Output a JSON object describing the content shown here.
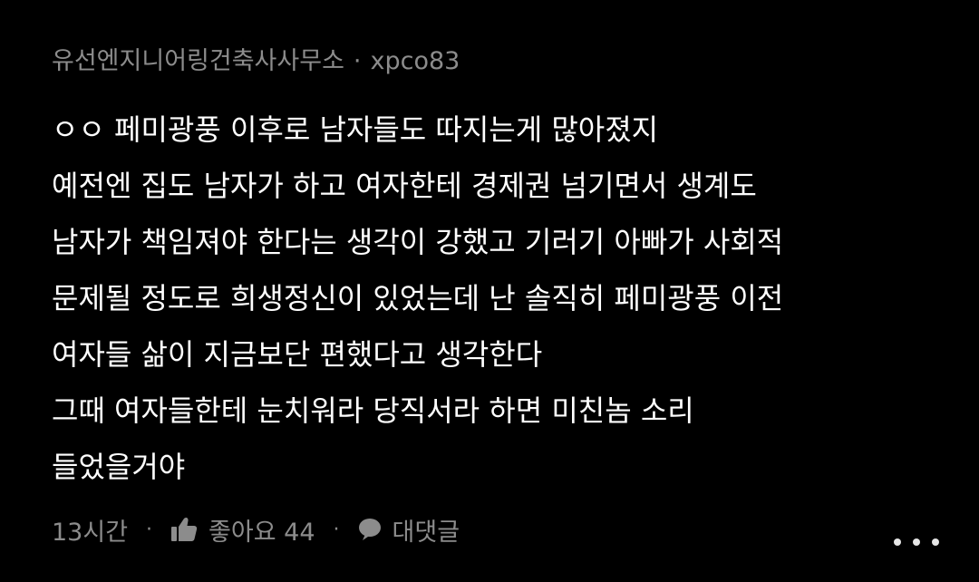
{
  "comment": {
    "author": "유선엔지니어링건축사사무소",
    "separator": "·",
    "username": "xpco83",
    "lines": [
      "ㅇㅇ 페미광풍 이후로 남자들도 따지는게 많아졌지",
      "예전엔 집도 남자가 하고 여자한테 경제권 넘기면서 생계도",
      "남자가 책임져야 한다는 생각이 강했고 기러기 아빠가 사회적",
      "문제될 정도로 희생정신이 있었는데 난 솔직히 페미광풍 이전",
      "여자들 삶이 지금보단 편했다고 생각한다",
      "그때 여자들한테 눈치워라 당직서라 하면 미친놈 소리",
      "들었을거야"
    ]
  },
  "footer": {
    "time": "13시간",
    "separator": "·",
    "like_label": "좋아요 44",
    "reply_label": "대댓글"
  },
  "icons": {
    "like": "thumbs-up-icon",
    "reply": "speech-bubble-icon",
    "more": "more-dots-icon"
  },
  "colors": {
    "background": "#000000",
    "text": "#ffffff",
    "muted": "#8c8c8c",
    "dots": "#e6e6e6"
  }
}
